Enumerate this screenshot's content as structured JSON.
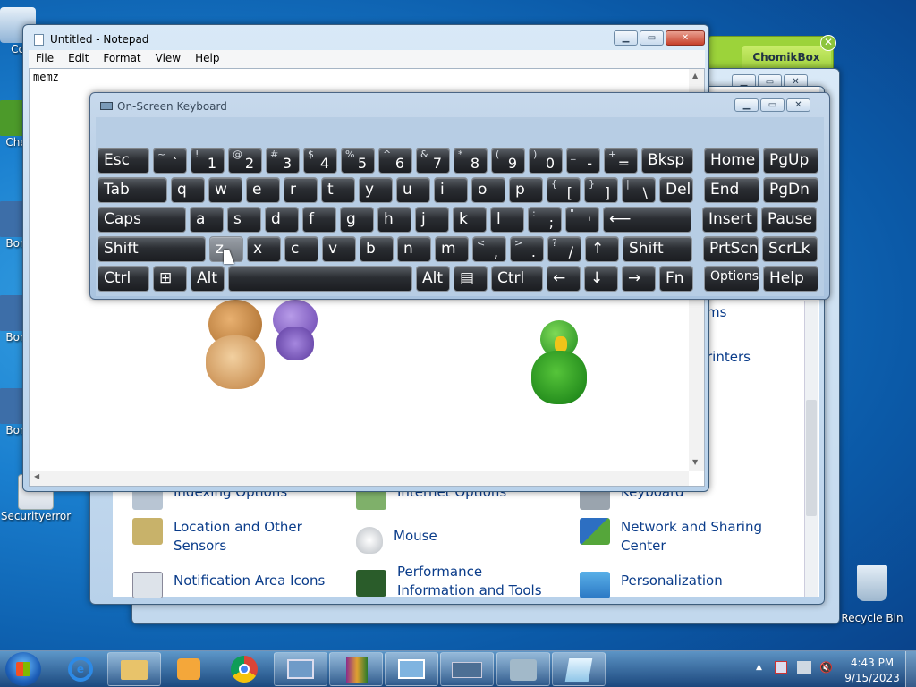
{
  "desktop": {
    "icons": [
      {
        "label": "Co"
      },
      {
        "label": "Che"
      },
      {
        "label": "Bon"
      },
      {
        "label": "Bon"
      },
      {
        "label": "Bon"
      },
      {
        "label": "Securityerror"
      },
      {
        "label": "Recycle Bin"
      }
    ]
  },
  "chomik": {
    "title": "ChomikBox"
  },
  "notepad": {
    "title": "Untitled - Notepad",
    "menu": [
      "File",
      "Edit",
      "Format",
      "View",
      "Help"
    ],
    "text": "memz"
  },
  "controlpanel": {
    "items": [
      {
        "label": "Indexing Options"
      },
      {
        "label": "Internet Options"
      },
      {
        "label": "Keyboard"
      },
      {
        "label": "Location and Other Sensors"
      },
      {
        "label": "Mouse"
      },
      {
        "label": "Network and Sharing Center"
      },
      {
        "label": "Notification Area Icons"
      },
      {
        "label": "Performance Information and Tools"
      },
      {
        "label": "Personalization"
      },
      {
        "label": "ms"
      },
      {
        "label": "rinters"
      }
    ]
  },
  "osk": {
    "title": "On-Screen Keyboard",
    "rows": [
      [
        {
          "m": "Esc"
        },
        {
          "sh": "~",
          "lo": "`"
        },
        {
          "sh": "!",
          "lo": "1"
        },
        {
          "sh": "@",
          "lo": "2"
        },
        {
          "sh": "#",
          "lo": "3"
        },
        {
          "sh": "$",
          "lo": "4"
        },
        {
          "sh": "%",
          "lo": "5"
        },
        {
          "sh": "^",
          "lo": "6"
        },
        {
          "sh": "&",
          "lo": "7"
        },
        {
          "sh": "*",
          "lo": "8"
        },
        {
          "sh": "(",
          "lo": "9"
        },
        {
          "sh": ")",
          "lo": "0"
        },
        {
          "sh": "_",
          "lo": "-"
        },
        {
          "sh": "+",
          "lo": "="
        },
        {
          "m": "Bksp"
        },
        {
          "m": "Home"
        },
        {
          "m": "PgUp"
        }
      ],
      [
        {
          "m": "Tab"
        },
        {
          "m": "q"
        },
        {
          "m": "w"
        },
        {
          "m": "e"
        },
        {
          "m": "r"
        },
        {
          "m": "t"
        },
        {
          "m": "y"
        },
        {
          "m": "u"
        },
        {
          "m": "i"
        },
        {
          "m": "o"
        },
        {
          "m": "p"
        },
        {
          "sh": "{",
          "lo": "["
        },
        {
          "sh": "}",
          "lo": "]"
        },
        {
          "sh": "|",
          "lo": "\\"
        },
        {
          "m": "Del"
        },
        {
          "m": "End"
        },
        {
          "m": "PgDn"
        }
      ],
      [
        {
          "m": "Caps"
        },
        {
          "m": "a"
        },
        {
          "m": "s"
        },
        {
          "m": "d"
        },
        {
          "m": "f"
        },
        {
          "m": "g"
        },
        {
          "m": "h"
        },
        {
          "m": "j"
        },
        {
          "m": "k"
        },
        {
          "m": "l"
        },
        {
          "sh": ":",
          "lo": ";"
        },
        {
          "sh": "\"",
          "lo": "'"
        },
        {
          "m": "⟵"
        },
        {
          "m": "Insert"
        },
        {
          "m": "Pause"
        }
      ],
      [
        {
          "m": "Shift"
        },
        {
          "m": "z"
        },
        {
          "m": "x"
        },
        {
          "m": "c"
        },
        {
          "m": "v"
        },
        {
          "m": "b"
        },
        {
          "m": "n"
        },
        {
          "m": "m"
        },
        {
          "sh": "<",
          "lo": ","
        },
        {
          "sh": ">",
          "lo": "."
        },
        {
          "sh": "?",
          "lo": "/"
        },
        {
          "m": "↑"
        },
        {
          "m": "Shift"
        },
        {
          "m": "PrtScn"
        },
        {
          "m": "ScrLk"
        }
      ],
      [
        {
          "m": "Ctrl"
        },
        {
          "m": "⊞"
        },
        {
          "m": "Alt"
        },
        {
          "m": ""
        },
        {
          "m": "Alt"
        },
        {
          "m": "▤"
        },
        {
          "m": "Ctrl"
        },
        {
          "m": "←"
        },
        {
          "m": "↓"
        },
        {
          "m": "→"
        },
        {
          "m": "Fn"
        },
        {
          "m": "Options"
        },
        {
          "m": "Help"
        }
      ]
    ]
  },
  "taskbar": {
    "time": "4:43 PM",
    "date": "9/15/2023",
    "apps": [
      "windows-explorer",
      "internet-explorer",
      "file-explorer",
      "media-player",
      "chrome",
      "remote-desktop",
      "winrar",
      "control-panel",
      "osk",
      "network-tool",
      "notepad"
    ]
  }
}
